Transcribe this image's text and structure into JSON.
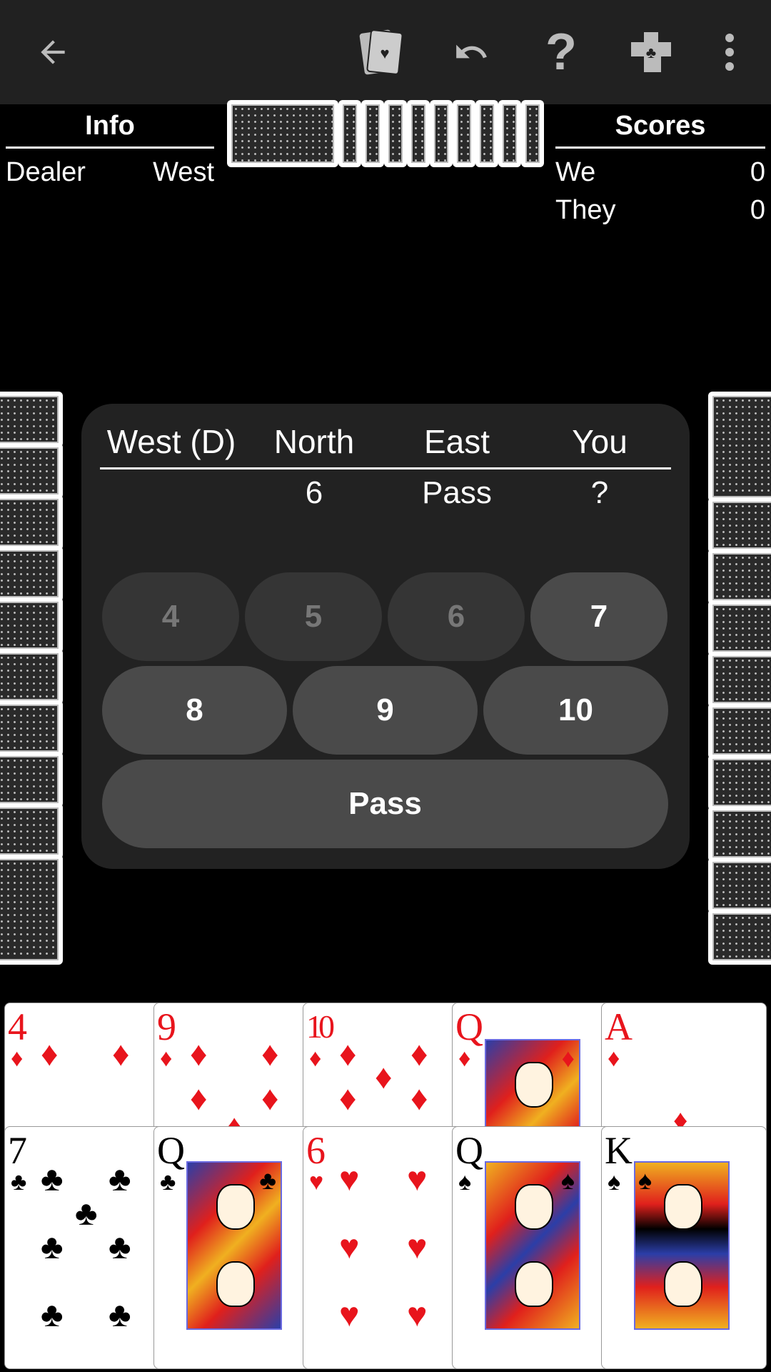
{
  "toolbar": {
    "back_icon": "arrow-left-icon",
    "cards_icon": "cards-hand-icon",
    "undo_icon": "undo-icon",
    "help_icon": "help-question-icon",
    "help_label": "?",
    "puzzle_icon": "puzzle-piece-icon",
    "menu_icon": "more-vertical-icon"
  },
  "info": {
    "title": "Info",
    "dealer_label": "Dealer",
    "dealer_value": "West"
  },
  "scores": {
    "title": "Scores",
    "we_label": "We",
    "we_value": "0",
    "they_label": "They",
    "they_value": "0"
  },
  "bidding": {
    "headers": [
      "West (D)",
      "North",
      "East",
      "You"
    ],
    "row": [
      "",
      "6",
      "Pass",
      "?"
    ],
    "buttons": [
      {
        "label": "4",
        "enabled": false
      },
      {
        "label": "5",
        "enabled": false
      },
      {
        "label": "6",
        "enabled": false
      },
      {
        "label": "7",
        "enabled": true
      },
      {
        "label": "8",
        "enabled": true
      },
      {
        "label": "9",
        "enabled": true
      },
      {
        "label": "10",
        "enabled": true
      }
    ],
    "pass_label": "Pass"
  },
  "hand": {
    "top_row": [
      {
        "rank": "4",
        "suit": "♦",
        "color": "#e8141c"
      },
      {
        "rank": "9",
        "suit": "♦",
        "color": "#e8141c"
      },
      {
        "rank": "10",
        "suit": "♦",
        "color": "#e8141c"
      },
      {
        "rank": "Q",
        "suit": "♦",
        "color": "#e8141c"
      },
      {
        "rank": "A",
        "suit": "♦",
        "color": "#e8141c"
      }
    ],
    "bottom_row": [
      {
        "rank": "7",
        "suit": "♣",
        "color": "#000000"
      },
      {
        "rank": "Q",
        "suit": "♣",
        "color": "#000000"
      },
      {
        "rank": "6",
        "suit": "♥",
        "color": "#e8141c"
      },
      {
        "rank": "Q",
        "suit": "♠",
        "color": "#000000"
      },
      {
        "rank": "K",
        "suit": "♠",
        "color": "#000000"
      }
    ]
  }
}
